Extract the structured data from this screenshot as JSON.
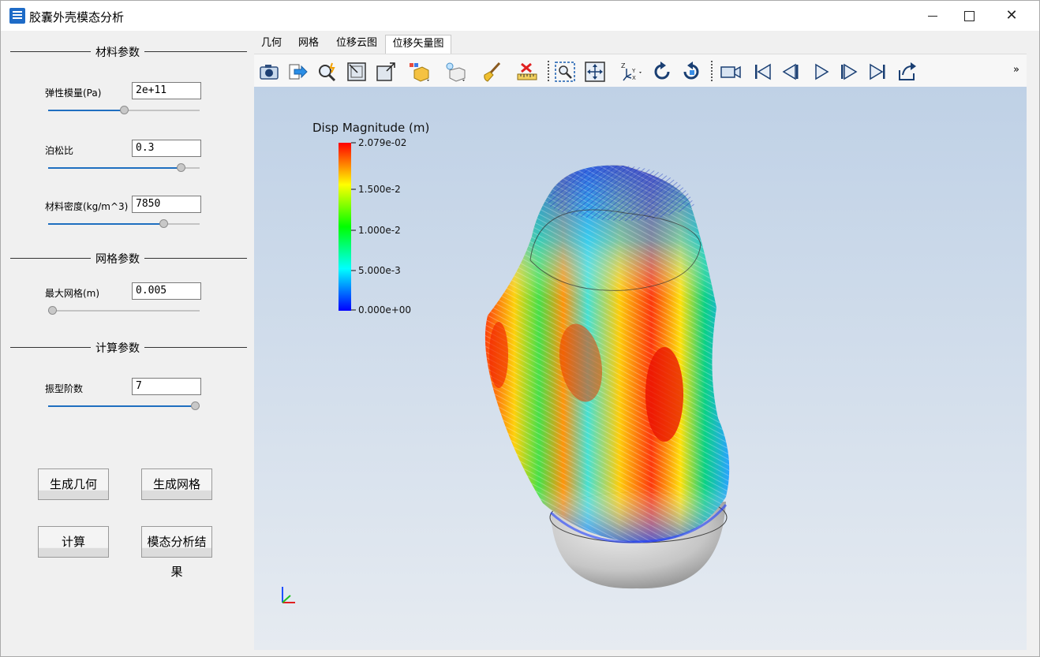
{
  "window": {
    "title": "胶囊外壳模态分析",
    "controls": [
      "minimize-icon",
      "maximize-icon",
      "close-icon"
    ]
  },
  "sidebar": {
    "material_group": {
      "title": "材料参数",
      "params": [
        {
          "label": "弹性模量(Pa)",
          "value": "2e+11",
          "slider_fraction": 0.5
        },
        {
          "label": "泊松比",
          "value": "0.3",
          "slider_fraction": 0.9
        },
        {
          "label": "材料密度(kg/m^3)",
          "value": "7850",
          "slider_fraction": 0.78
        }
      ]
    },
    "mesh_group": {
      "title": "网格参数",
      "params": [
        {
          "label": "最大网格(m)",
          "value": "0.005",
          "slider_fraction": 0.0
        }
      ]
    },
    "calc_group": {
      "title": "计算参数",
      "params": [
        {
          "label": "振型阶数",
          "value": "7",
          "slider_fraction": 1.0
        }
      ]
    },
    "buttons": {
      "gen_geometry": "生成几何",
      "gen_mesh": "生成网格",
      "compute": "计算",
      "modal_result": "模态分析结果"
    }
  },
  "tabs": [
    {
      "label": "几何",
      "active": false
    },
    {
      "label": "网格",
      "active": false
    },
    {
      "label": "位移云图",
      "active": false
    },
    {
      "label": "位移矢量图",
      "active": true
    }
  ],
  "toolbar": {
    "icons": [
      "camera-icon",
      "export-arrow-icon",
      "zoom-magic-icon",
      "reset-camera-icon",
      "open-window-icon",
      "display-mode-icon",
      "light-icon",
      "brush-icon",
      "ruler-icon",
      "zoom-box-icon",
      "fit-view-icon",
      "axes-orient-icon",
      "rotate-cw-icon",
      "rotate-ccw-icon",
      "record-camera-icon",
      "first-frame-icon",
      "prev-frame-icon",
      "play-icon",
      "next-frame-icon",
      "last-frame-icon",
      "loop-icon"
    ],
    "more": "»"
  },
  "viewport": {
    "colorbar": {
      "title": "Disp Magnitude (m)",
      "ticks": [
        "2.079e-02",
        "1.500e-2",
        "1.000e-2",
        "5.000e-3",
        "0.000e+00"
      ],
      "colors": [
        "#0000ff",
        "#00ffff",
        "#00ff00",
        "#ffff00",
        "#ff0000"
      ]
    }
  }
}
